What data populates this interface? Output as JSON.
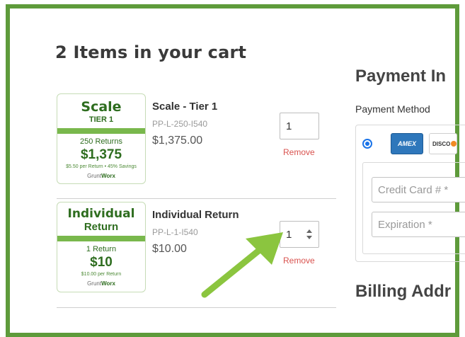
{
  "cart": {
    "title": "2  Items in your cart",
    "items": [
      {
        "thumb": {
          "name": "Scale",
          "sub": "TIER 1",
          "returns": "250 Returns",
          "price": "$1,375",
          "note": "$5.50 per Return • 45% Savings",
          "brand_a": "Grunt",
          "brand_b": "Worx"
        },
        "name": "Scale - Tier 1",
        "sku": "PP-L-250-I540",
        "price": "$1,375.00",
        "quantity": "1",
        "remove_label": "Remove"
      },
      {
        "thumb": {
          "name": "Individual",
          "sub": "Return",
          "returns": "1 Return",
          "price": "$10",
          "note": "$10.00 per Return",
          "brand_a": "Grunt",
          "brand_b": "Worx"
        },
        "name": "Individual Return",
        "sku": "PP-L-1-I540",
        "price": "$10.00",
        "quantity": "1",
        "remove_label": "Remove"
      }
    ]
  },
  "payment": {
    "title": "Payment In",
    "method_label": "Payment Method",
    "cards": [
      "AMEX",
      "DISCO"
    ],
    "fields": {
      "credit_card_placeholder": "Credit Card # *",
      "expiration_placeholder": "Expiration *"
    }
  },
  "billing": {
    "title": "Billing Addr"
  },
  "colors": {
    "frame": "#5e9b3b",
    "brand_green": "#2e6d1f",
    "bar_green": "#79b84c",
    "remove_red": "#d9534f",
    "radio_blue": "#1a73e8",
    "arrow_green": "#8bc53f"
  },
  "icons": {
    "stepper": "up-down-chevron-icon",
    "arrow": "annotation-arrow-icon"
  }
}
